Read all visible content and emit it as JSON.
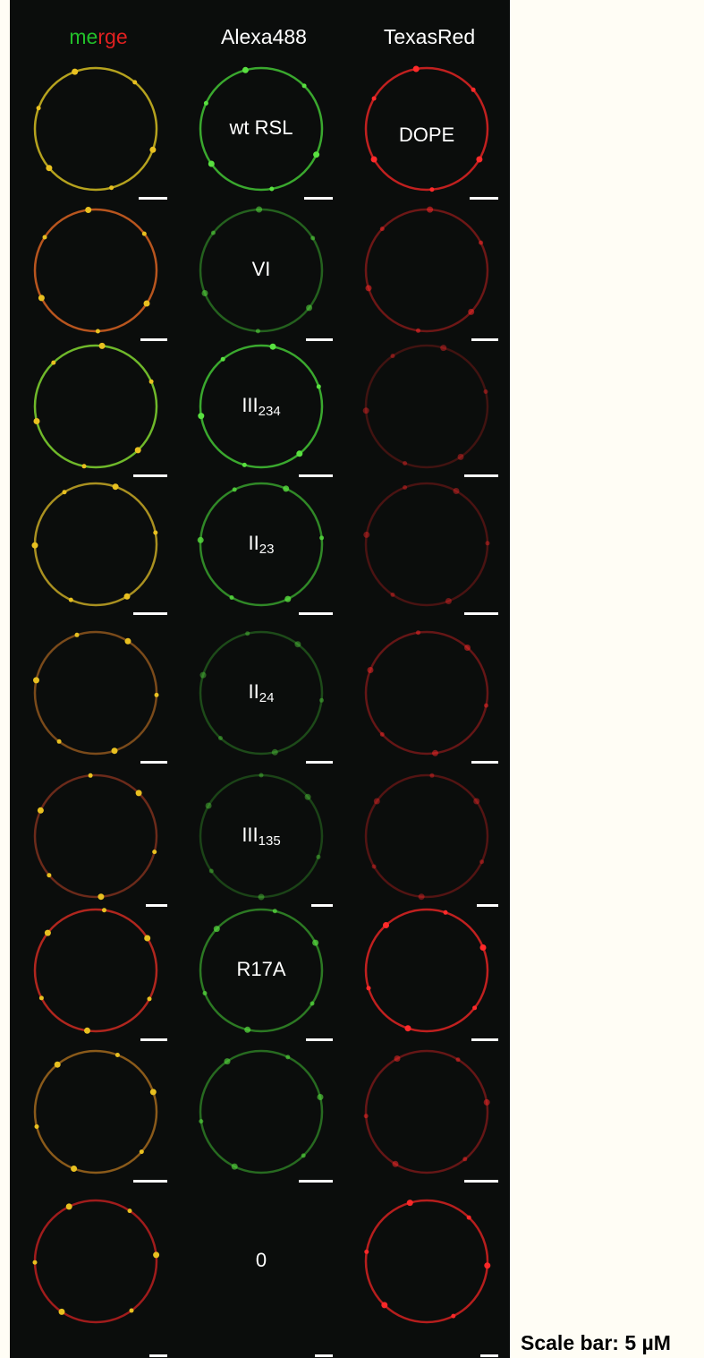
{
  "header": {
    "merge": {
      "m": "m",
      "e": "e",
      "r": "r",
      "g": "g",
      "e2": "e"
    },
    "alexa": "Alexa488",
    "texas": "TexasRed"
  },
  "colors": {
    "merge_green": "#22c02a",
    "merge_red": "#e02020",
    "green_ring": "#3aa82e",
    "red_ring": "#c0201f",
    "yellow_ring": "#b69a1e"
  },
  "rows": [
    {
      "label": "wt RSL",
      "label_sub": "",
      "right_label": "DOPE"
    },
    {
      "label": "VI",
      "label_sub": "",
      "right_label": ""
    },
    {
      "label": "III",
      "label_sub": "234",
      "right_label": ""
    },
    {
      "label": "II",
      "label_sub": "23",
      "right_label": ""
    },
    {
      "label": "II",
      "label_sub": "24",
      "right_label": ""
    },
    {
      "label": "III",
      "label_sub": "135",
      "right_label": ""
    },
    {
      "label": "R17A",
      "label_sub": "",
      "right_label": ""
    },
    {
      "label": "",
      "label_sub": "",
      "right_label": ""
    },
    {
      "label": "0",
      "label_sub": "",
      "right_label": ""
    }
  ],
  "scale_text": "Scale bar: 5 µM"
}
